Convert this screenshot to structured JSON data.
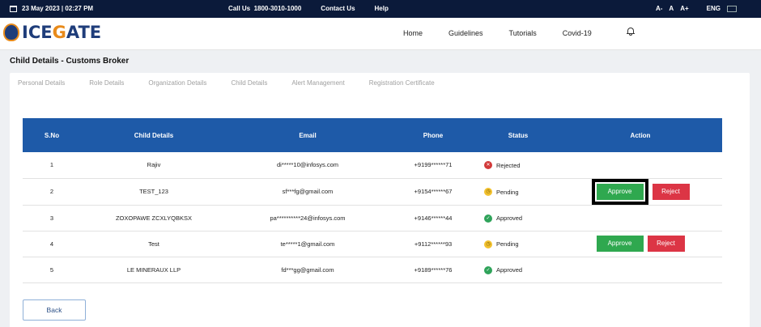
{
  "topbar": {
    "datetime": "23 May 2023 | 02:27 PM",
    "call_us_label": "Call Us",
    "call_us_number": "1800-3010-1000",
    "contact_us": "Contact Us",
    "help": "Help",
    "font_small": "A-",
    "font_normal": "A",
    "font_large": "A+",
    "language": "ENG"
  },
  "header": {
    "logo_prefix": "ICE",
    "logo_accent": "G",
    "logo_suffix": "ATE",
    "nav": [
      "Home",
      "Guidelines",
      "Tutorials",
      "Covid-19"
    ]
  },
  "page": {
    "title": "Child Details - Customs Broker",
    "tabs": [
      "Personal Details",
      "Role Details",
      "Organization Details",
      "Child Details",
      "Alert Management",
      "Registration Certificate"
    ]
  },
  "table": {
    "columns": [
      "S.No",
      "Child Details",
      "Email",
      "Phone",
      "Status",
      "Action"
    ],
    "rows": [
      {
        "sno": "1",
        "child": "Rajiv",
        "email": "di*****10@infosys.com",
        "phone": "+9199******71",
        "status": "Rejected"
      },
      {
        "sno": "2",
        "child": "TEST_123",
        "email": "sf***fg@gmail.com",
        "phone": "+9154******67",
        "status": "Pending"
      },
      {
        "sno": "3",
        "child": "ZOXOPAWE ZCXLYQBKSX",
        "email": "pa**********24@infosys.com",
        "phone": "+9146******44",
        "status": "Approved"
      },
      {
        "sno": "4",
        "child": "Test",
        "email": "te*****1@gmail.com",
        "phone": "+9112******93",
        "status": "Pending"
      },
      {
        "sno": "5",
        "child": "LE MINERAUX LLP",
        "email": "fd***gg@gmail.com",
        "phone": "+9189******76",
        "status": "Approved"
      }
    ],
    "approve_label": "Approve",
    "reject_label": "Reject"
  },
  "back_label": "Back",
  "colors": {
    "topbar_bg": "#0b1a3a",
    "table_header_bg": "#1e5aa8",
    "approve": "#2fa84f",
    "reject": "#dc3545",
    "rejected_status": "#d23a3a",
    "pending_status": "#f2c12e",
    "approved_status": "#2fa35a"
  },
  "icons": {
    "calendar": "calendar-icon",
    "bell": "bell-icon",
    "rejected": "close-circle-icon",
    "pending": "clock-circle-icon",
    "approved": "check-circle-icon"
  }
}
